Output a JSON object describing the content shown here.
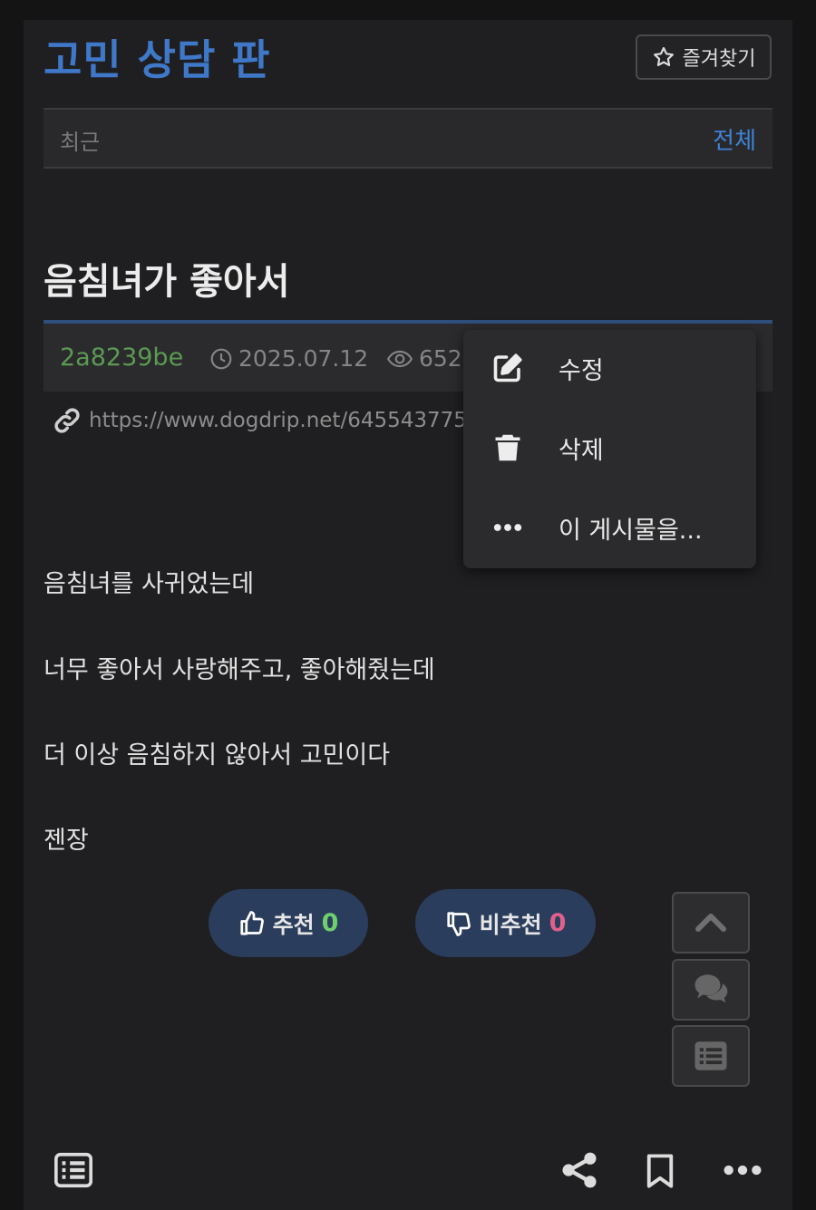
{
  "board": {
    "title": "고민 상담 판",
    "favorite_label": "즐겨찾기"
  },
  "tabs": {
    "recent": "최근",
    "all": "전체"
  },
  "post": {
    "title": "음침녀가 좋아서",
    "author": "2a8239be",
    "date": "2025.07.12",
    "views": "652",
    "url": "https://www.dogdrip.net/645543775",
    "paragraphs": [
      "음침녀를 사귀었는데",
      "너무 좋아서 사랑해주고, 좋아해줬는데",
      "더 이상 음침하지 않아서 고민이다",
      "젠장"
    ]
  },
  "context_menu": {
    "items": [
      {
        "label": "수정",
        "icon": "edit-icon"
      },
      {
        "label": "삭제",
        "icon": "trash-icon"
      },
      {
        "label": "이 게시물을...",
        "icon": "more-dots-icon"
      }
    ]
  },
  "votes": {
    "up_label": "추천",
    "up_count": "0",
    "down_label": "비추천",
    "down_count": "0"
  },
  "colors": {
    "accent": "#3f78c8",
    "author": "#5b9a52",
    "vote_bg": "#2a3d5c",
    "up_count": "#6fcf6f",
    "down_count": "#e0608a"
  }
}
